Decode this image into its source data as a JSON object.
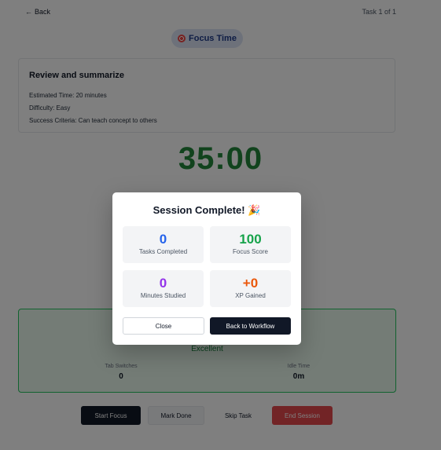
{
  "topbar": {
    "back_label": "Back",
    "task_counter": "Task 1 of 1"
  },
  "mode_pill": {
    "label": "Focus Time",
    "icon": "target-icon"
  },
  "task_card": {
    "title": "Review and summarize",
    "estimated_time": "Estimated Time: 20 minutes",
    "difficulty": "Difficulty: Easy",
    "success_criteria": "Success Criteria: Can teach concept to others"
  },
  "timer": {
    "value": "35:00"
  },
  "focus_panel": {
    "quality_label": "Excellent",
    "tab_switches_label": "Tab Switches",
    "tab_switches_value": "0",
    "idle_time_label": "Idle Time",
    "idle_time_value": "0m"
  },
  "actions": {
    "start_focus": "Start Focus",
    "mark_done": "Mark Done",
    "skip_task": "Skip Task",
    "end_session": "End Session"
  },
  "modal": {
    "title": "Session Complete! 🎉",
    "stats": [
      {
        "value": "0",
        "label": "Tasks Completed",
        "color": "#2563eb"
      },
      {
        "value": "100",
        "label": "Focus Score",
        "color": "#16a34a"
      },
      {
        "value": "0",
        "label": "Minutes Studied",
        "color": "#9333ea"
      },
      {
        "value": "+0",
        "label": "XP Gained",
        "color": "#ea580c"
      }
    ],
    "close_label": "Close",
    "back_to_workflow_label": "Back to Workflow"
  }
}
